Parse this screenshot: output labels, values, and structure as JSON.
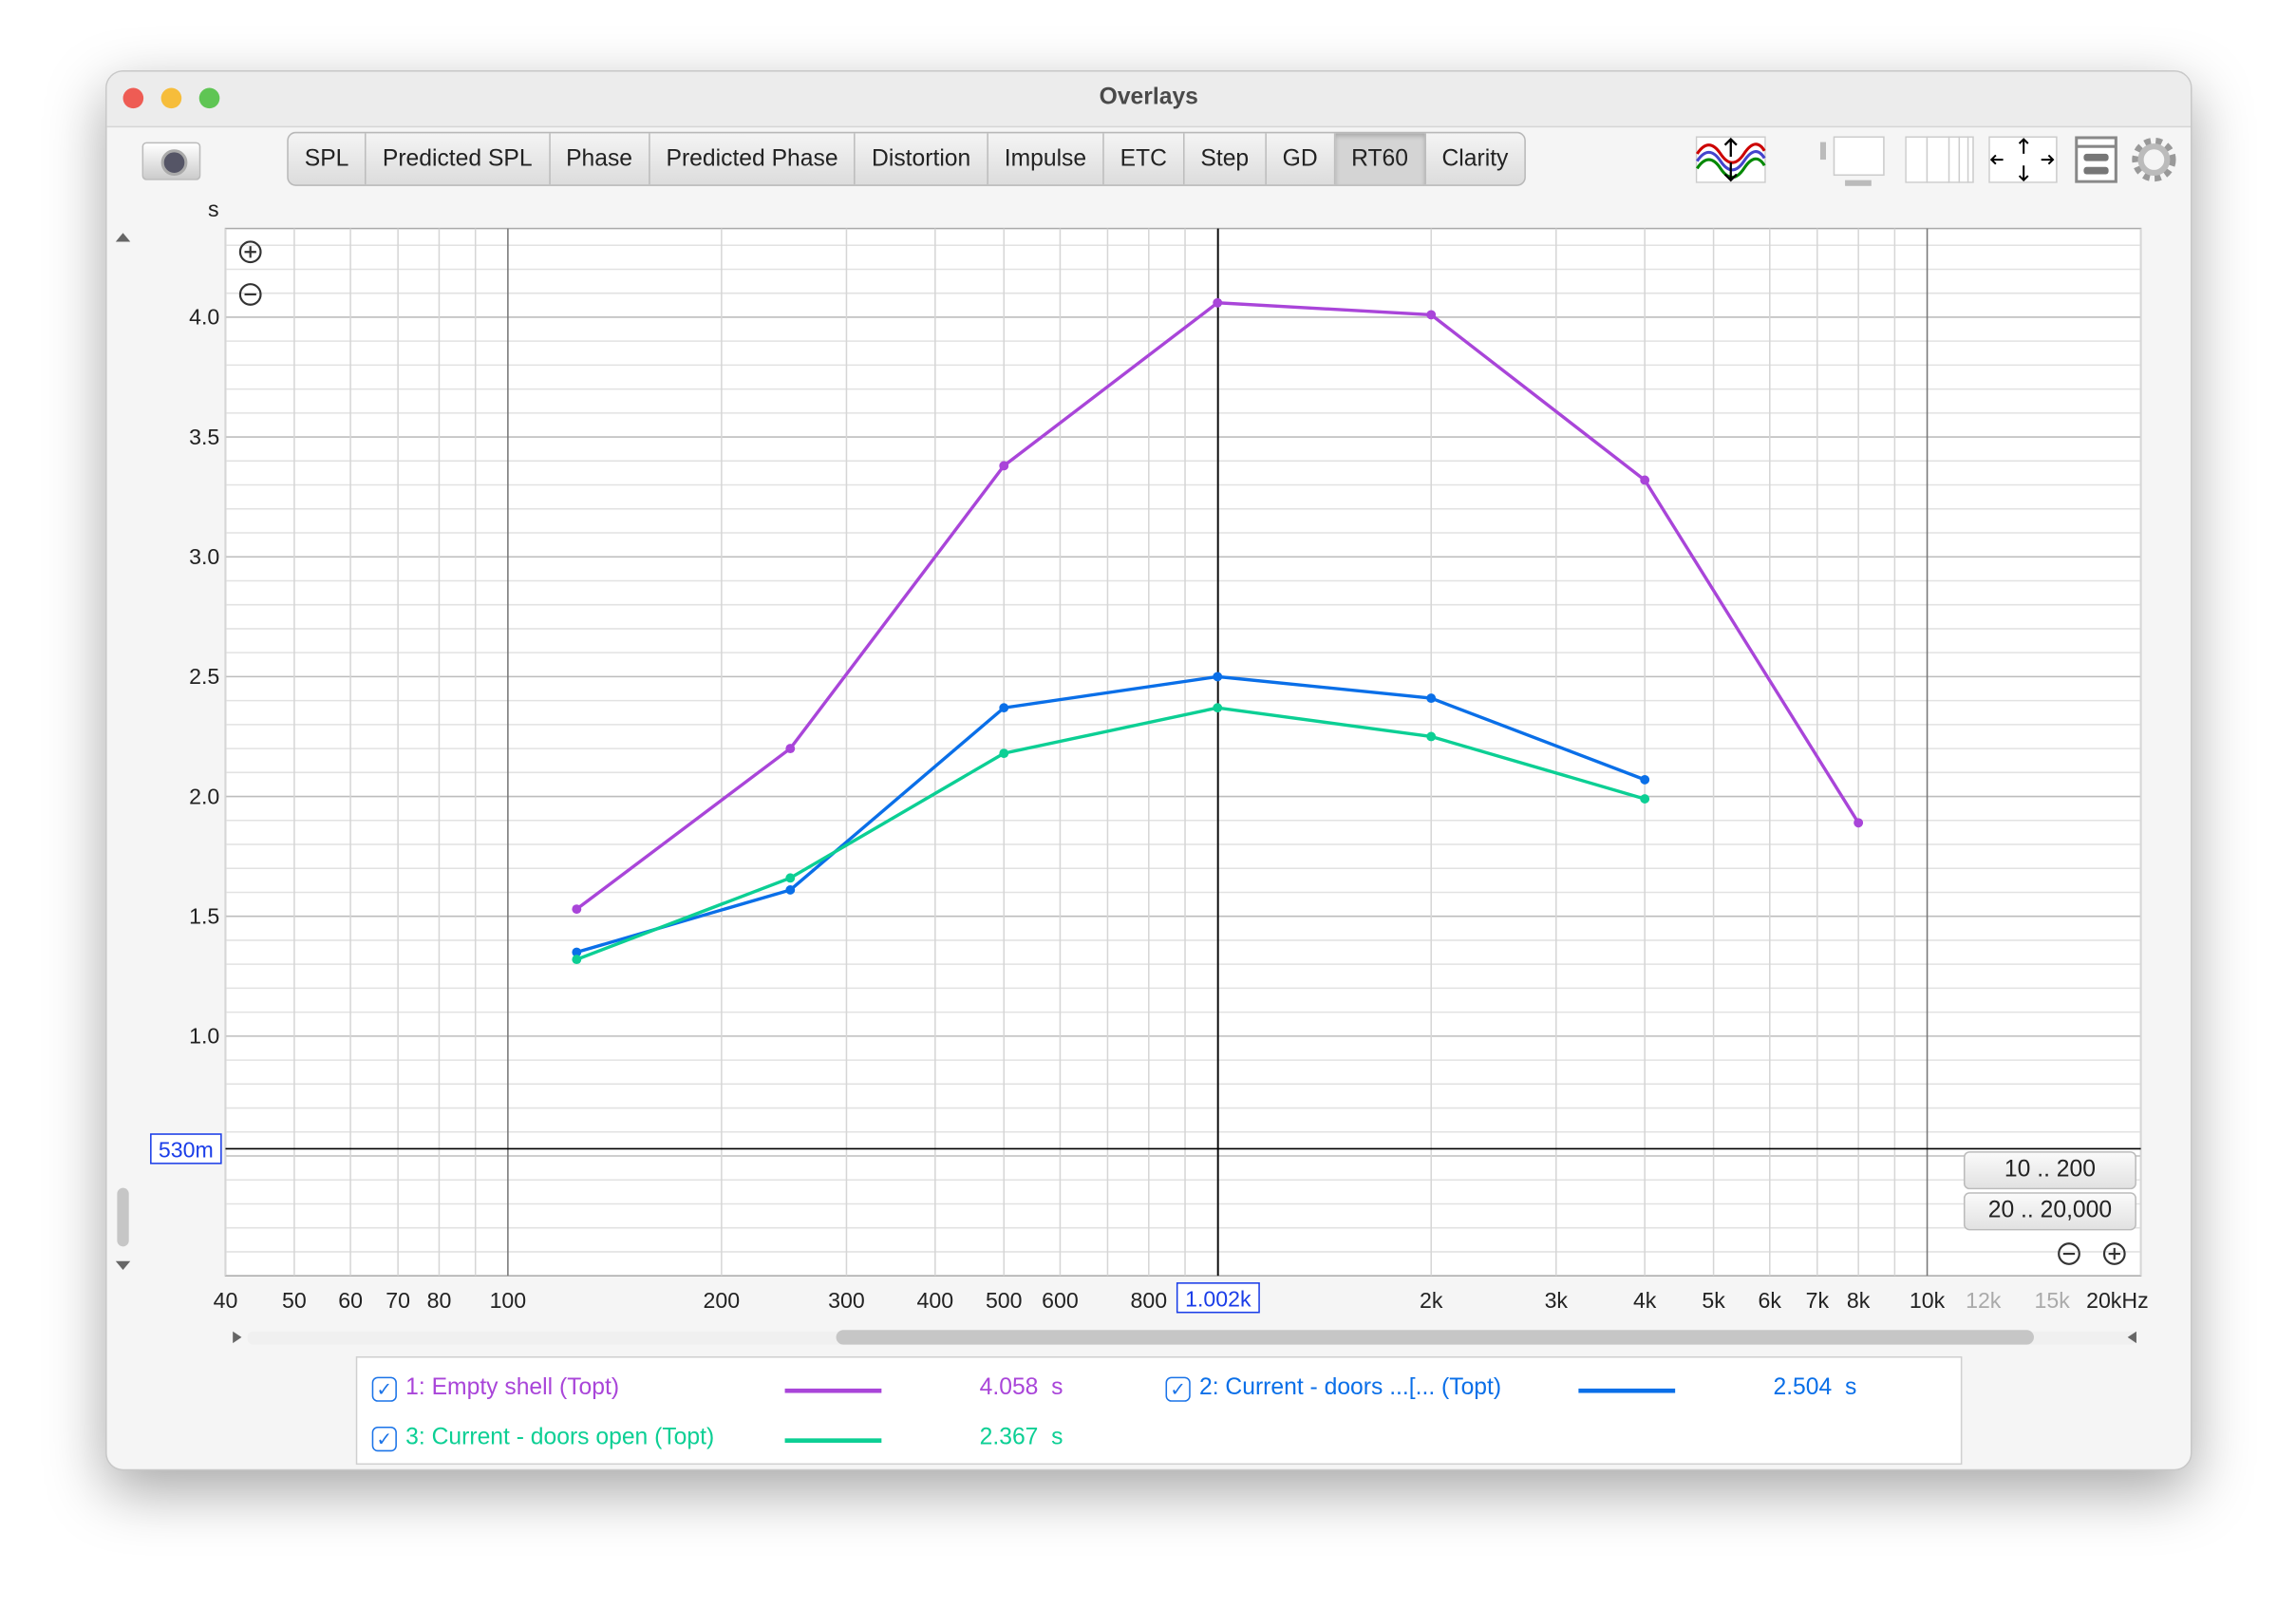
{
  "window": {
    "title": "Overlays"
  },
  "toolbar": {
    "tabs": [
      "SPL",
      "Predicted SPL",
      "Phase",
      "Predicted Phase",
      "Distortion",
      "Impulse",
      "ETC",
      "Step",
      "GD",
      "RT60",
      "Clarity"
    ],
    "active": "RT60",
    "icons": [
      "camera-icon",
      "trace-arrange-icon",
      "layout-single-icon",
      "layout-columns-icon",
      "pan-arrows-icon",
      "controls-panel-icon",
      "gear-icon"
    ]
  },
  "ranges": {
    "low": "10 .. 200",
    "full": "20 .. 20,000"
  },
  "cursor": {
    "y_readout": "530m",
    "x_readout": "1.002k"
  },
  "chart_data": {
    "type": "line",
    "ylabel": "s",
    "xscale": "log",
    "xlim": [
      40,
      20000
    ],
    "ylim": [
      0,
      4.37
    ],
    "grid": true,
    "legend": "bottom",
    "x_ticks": [
      "40",
      "50",
      "60",
      "70",
      "80",
      "100",
      "200",
      "300",
      "400",
      "500",
      "600",
      "800",
      "2k",
      "3k",
      "4k",
      "5k",
      "6k",
      "7k",
      "8k",
      "10k",
      "12k",
      "15k",
      "20kHz"
    ],
    "y_ticks": [
      "1.0",
      "1.5",
      "2.0",
      "2.5",
      "3.0",
      "3.5",
      "4.0"
    ],
    "cursor": {
      "x": 1002,
      "y": 0.53
    },
    "series": [
      {
        "name": "1: Empty shell (Topt)",
        "color": "#a945d9",
        "cursor_value": "4.058",
        "unit": "s",
        "x": [
          125,
          250,
          500,
          1000,
          2000,
          4000,
          8000
        ],
        "y": [
          1.53,
          2.2,
          3.38,
          4.06,
          4.01,
          3.32,
          1.89
        ]
      },
      {
        "name": "2: Current - doors ...[... (Topt)",
        "color": "#0a6fe8",
        "cursor_value": "2.504",
        "unit": "s",
        "x": [
          125,
          250,
          500,
          1000,
          2000,
          4000
        ],
        "y": [
          1.35,
          1.61,
          2.37,
          2.5,
          2.41,
          2.07
        ]
      },
      {
        "name": "3: Current - doors open (Topt)",
        "color": "#0ccf94",
        "cursor_value": "2.367",
        "unit": "s",
        "x": [
          125,
          250,
          500,
          1000,
          2000,
          4000
        ],
        "y": [
          1.32,
          1.66,
          2.18,
          2.37,
          2.25,
          1.99
        ]
      }
    ]
  }
}
